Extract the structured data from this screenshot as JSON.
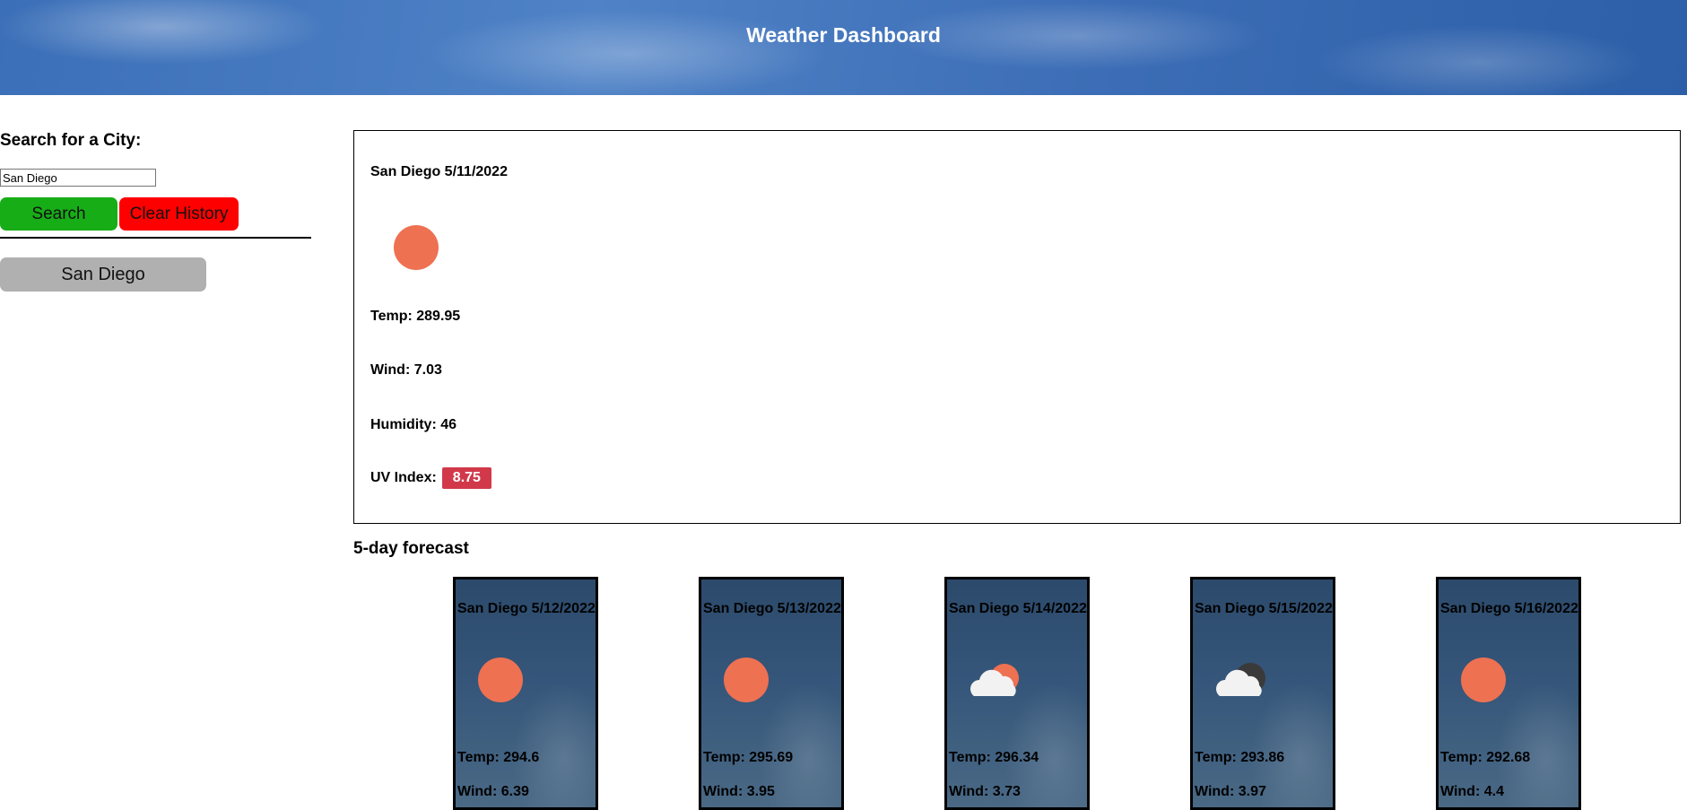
{
  "header": {
    "title": "Weather Dashboard"
  },
  "sidebar": {
    "search_heading": "Search for a City:",
    "search_input_value": "San Diego",
    "search_button": "Search",
    "clear_button": "Clear History",
    "history": [
      "San Diego"
    ]
  },
  "current": {
    "title": "San Diego 5/11/2022",
    "icon": "sun-icon",
    "temp": "Temp: 289.95",
    "wind": "Wind: 7.03",
    "humidity": "Humidity: 46",
    "uv_label": "UV Index:",
    "uv_value": "8.75",
    "uv_color": "#d1394b"
  },
  "forecast": {
    "heading": "5-day forecast",
    "days": [
      {
        "date": "San Diego 5/12/2022",
        "icon": "sun-icon",
        "temp": "Temp: 294.6",
        "wind": "Wind: 6.39"
      },
      {
        "date": "San Diego 5/13/2022",
        "icon": "sun-icon",
        "temp": "Temp: 295.69",
        "wind": "Wind: 3.95"
      },
      {
        "date": "San Diego 5/14/2022",
        "icon": "partly-cloudy-icon",
        "temp": "Temp: 296.34",
        "wind": "Wind: 3.73"
      },
      {
        "date": "San Diego 5/15/2022",
        "icon": "cloudy-icon",
        "temp": "Temp: 293.86",
        "wind": "Wind: 3.97"
      },
      {
        "date": "San Diego 5/16/2022",
        "icon": "sun-icon",
        "temp": "Temp: 292.68",
        "wind": "Wind: 4.4"
      }
    ]
  },
  "colors": {
    "search_button": "#17ad17",
    "clear_button": "#ff0000",
    "history_button": "#b0b0b0",
    "sun": "#ee7152",
    "header_blue": "#3b6fb8"
  }
}
